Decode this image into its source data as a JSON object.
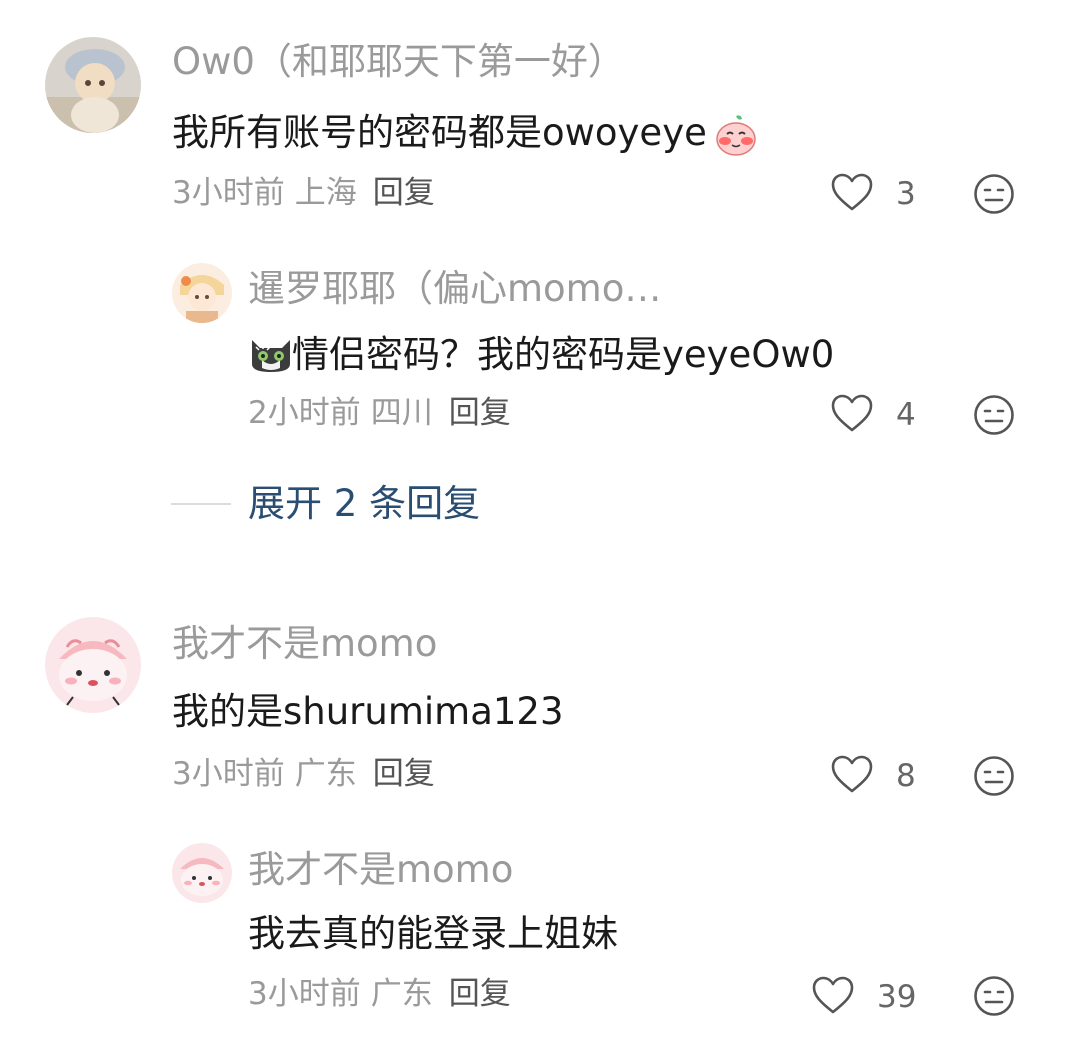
{
  "comments": [
    {
      "username": "Ow0（和耶耶天下第一好）",
      "text": "我所有账号的密码都是owoyeye",
      "text_emoji": "blushing-peach-emoji",
      "time": "3小时前",
      "location": "上海",
      "reply_label": "回复",
      "likes": "3"
    },
    {
      "username": "暹罗耶耶（偏心momo…",
      "text_emoji": "gray-cat-emoji",
      "text": "情侣密码？我的密码是yeyeOw0",
      "time": "2小时前",
      "location": "四川",
      "reply_label": "回复",
      "likes": "4"
    },
    {
      "username": "我才不是momo",
      "text": "我的是shurumima123",
      "time": "3小时前",
      "location": "广东",
      "reply_label": "回复",
      "likes": "8"
    },
    {
      "username": "我才不是momo",
      "text": "我去真的能登录上姐妹",
      "time": "3小时前",
      "location": "广东",
      "reply_label": "回复",
      "likes": "39"
    }
  ],
  "expand_label": "展开 2 条回复",
  "colors": {
    "accent": "#2a4d72",
    "meta": "#9a9a9a",
    "text": "#1a1a1a"
  }
}
